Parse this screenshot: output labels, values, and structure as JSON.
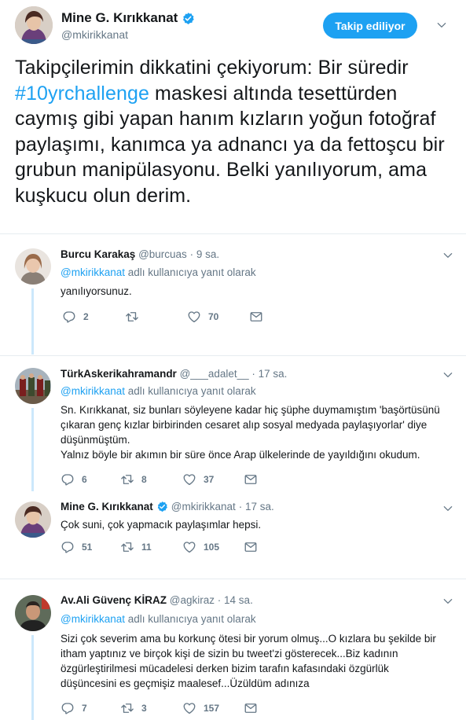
{
  "main_tweet": {
    "name": "Mine G. Kırıkkanat",
    "handle": "@mkirikkanat",
    "follow_label": "Takip ediliyor",
    "text_before": "Takipçilerimin dikkatini çekiyorum: Bir süredir ",
    "hashtag": "#10yrchallenge",
    "text_after": " maskesi altında tesettürden caymış gibi yapan  hanım kızların yoğun fotoğraf paylaşımı, kanımca ya adnancı ya da fettoşcu bir grubun manipülasyonu. Belki yanılıyorum, ama kuşkucu olun derim."
  },
  "replies": [
    {
      "name": "Burcu Karakaş",
      "handle": "@burcuas",
      "time": "· 9 sa.",
      "replying_mention": "@mkirikkanat",
      "replying_suffix": " adlı kullanıcıya yanıt olarak",
      "text": "yanılıyorsunuz.",
      "replies": "2",
      "retweets": "",
      "likes": "70"
    },
    {
      "name": "TürkAskerikahramandr",
      "handle": "@___adalet__",
      "time": "· 17 sa.",
      "replying_mention": "@mkirikkanat",
      "replying_suffix": " adlı kullanıcıya yanıt olarak",
      "text_p1": "Sn. Kırıkkanat, siz bunları söyleyene kadar hiç şüphe duymamıştım 'başörtüsünü çıkaran genç kızlar birbirinden cesaret alıp sosyal medyada paylaşıyorlar' diye düşünmüştüm.",
      "text_p2": "Yalnız böyle bir akımın bir süre önce Arap ülkelerinde de yayıldığını okudum.",
      "replies": "6",
      "retweets": "8",
      "likes": "37"
    },
    {
      "name": "Mine G. Kırıkkanat",
      "handle": "@mkirikkanat",
      "time": "· 17 sa.",
      "text": "Çok suni, çok yapmacık paylaşımlar hepsi.",
      "replies": "51",
      "retweets": "11",
      "likes": "105"
    },
    {
      "name": "Av.Ali Güvenç KİRAZ",
      "handle": "@agkiraz",
      "time": "· 14 sa.",
      "replying_mention": "@mkirikkanat",
      "replying_suffix": " adlı kullanıcıya yanıt olarak",
      "text": "Sizi çok severim ama bu korkunç ötesi bir yorum olmuş...O kızlara bu şekilde bir itham yaptınız ve birçok kişi de sizin bu tweet'zi gösterecek...Biz kadının özgürleştirilmesi mücadelesi derken bizim tarafın kafasındaki özgürlük düşüncesini es geçmişiz maalesef...Üzüldüm adınıza",
      "replies": "7",
      "retweets": "3",
      "likes": "157"
    }
  ],
  "colors": {
    "accent": "#1da1f2",
    "text": "#14171a",
    "muted": "#657786",
    "thread": "#cce8fb",
    "divider": "#e6ecf0"
  },
  "icons": [
    "verified-icon",
    "chevron-down-icon",
    "reply-icon",
    "retweet-icon",
    "like-icon",
    "message-icon"
  ]
}
